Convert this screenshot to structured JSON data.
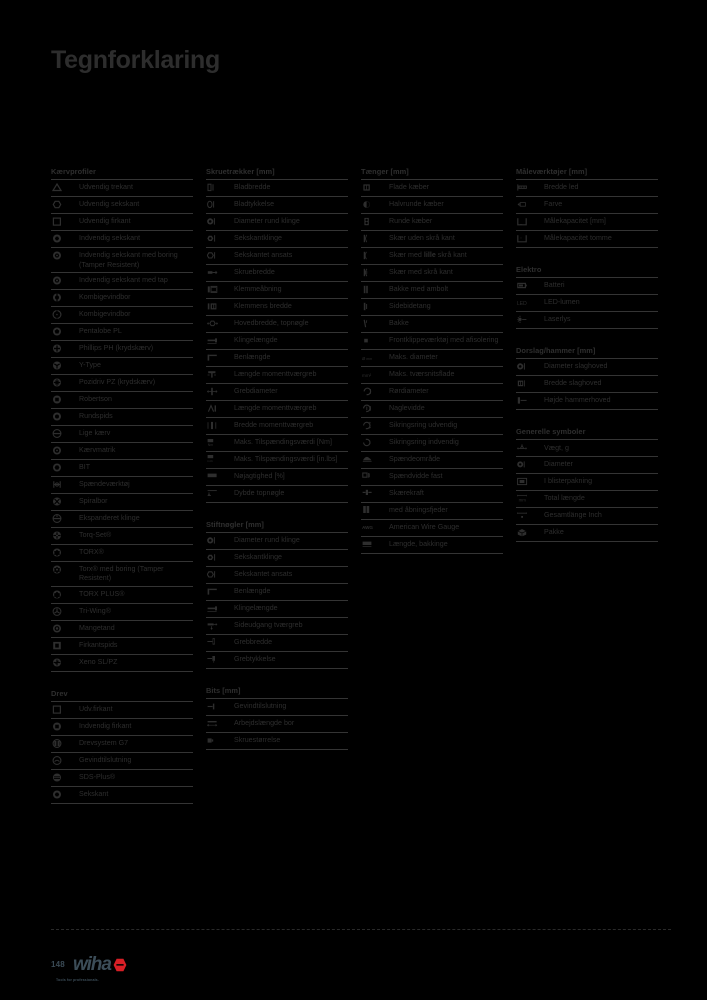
{
  "page": {
    "title": "Tegnforklaring",
    "number": "148",
    "brand": "wiha",
    "brand_tagline": "Tools for professionals."
  },
  "colors": {
    "background": "#000000",
    "text": "#2e2e2e",
    "rule": "#343434",
    "brand_blue": "#3c4d58",
    "brand_red": "#d81f26"
  },
  "columns": [
    {
      "sections": [
        {
          "title": "Kærvprofiler",
          "rows": [
            {
              "icon": "outer-triangle-icon",
              "label": "Udvendig trekant"
            },
            {
              "icon": "outer-hexagon-icon",
              "label": "Udvendig sekskant"
            },
            {
              "icon": "outer-square-icon",
              "label": "Udvendig firkant"
            },
            {
              "icon": "inner-hexagon-icon",
              "label": "Indvendig sekskant"
            },
            {
              "icon": "inner-hexagon-bore-icon",
              "label": "Indvendig sekskant med boring (Tamper Resistent)"
            },
            {
              "icon": "inner-hexagon-pin-icon",
              "label": "Indvendig sekskant med tap"
            },
            {
              "icon": "combi-thread-drill-icon",
              "label": "Kombigevindbor"
            },
            {
              "icon": "combi-thread-drill-open-icon",
              "label": "Kombigevindbor"
            },
            {
              "icon": "pentalobe-icon",
              "label": "Pentalobe PL"
            },
            {
              "icon": "phillips-ph-icon",
              "label": "Phillips PH (krydskærv)"
            },
            {
              "icon": "y-type-icon",
              "label": "Y-Type"
            },
            {
              "icon": "pozidriv-pz-icon",
              "label": "Pozidriv PZ (krydskærv)"
            },
            {
              "icon": "robertson-icon",
              "label": "Robertson"
            },
            {
              "icon": "round-socket-icon",
              "label": "Rundspids"
            },
            {
              "icon": "slotted-icon",
              "label": "Lige kærv"
            },
            {
              "icon": "kaervmatrik-icon",
              "label": "Kærvmatrik"
            },
            {
              "icon": "bit-icon",
              "label": "BIT"
            },
            {
              "icon": "tensioning-tool-icon",
              "label": "Spændeværktøj"
            },
            {
              "icon": "spiral-drill-icon",
              "label": "Spiralbor"
            },
            {
              "icon": "expanding-blade-icon",
              "label": "Ekspanderet klinge"
            },
            {
              "icon": "torq-set-icon",
              "label": "Torq-Set®"
            },
            {
              "icon": "torx-icon",
              "label": "TORX®"
            },
            {
              "icon": "torx-bore-icon",
              "label": "Torx® med boring (Tamper Resistent)"
            },
            {
              "icon": "torx-plus-icon",
              "label": "TORX PLUS®"
            },
            {
              "icon": "tri-wing-icon",
              "label": "Tri-Wing®"
            },
            {
              "icon": "many-teeth-icon",
              "label": "Mangetand"
            },
            {
              "icon": "square-tip-icon",
              "label": "Firkantspids"
            },
            {
              "icon": "xeno-slpz-icon",
              "label": "Xeno SL/PZ"
            }
          ]
        },
        {
          "title": "Drev",
          "rows": [
            {
              "icon": "outer-square-icon",
              "label": "Udv.firkant"
            },
            {
              "icon": "inner-square-icon",
              "label": "Indvendig firkant"
            },
            {
              "icon": "drive-system-g7-icon",
              "label": "Drevsystem G7"
            },
            {
              "icon": "thread-connection-icon",
              "label": "Gevindtilslutning"
            },
            {
              "icon": "sds-plus-icon",
              "label": "SDS-Plus®"
            },
            {
              "icon": "hexagon-icon",
              "label": "Sekskant"
            }
          ]
        }
      ]
    },
    {
      "sections": [
        {
          "title": "Skruetrækker [mm]",
          "rows": [
            {
              "icon": "blade-width-icon",
              "label": "Bladbredde"
            },
            {
              "icon": "blade-thickness-icon",
              "label": "Bladtykkelse"
            },
            {
              "icon": "round-blade-diameter-icon",
              "label": "Diameter rund klinge"
            },
            {
              "icon": "hex-blade-icon",
              "label": "Sekskantklinge"
            },
            {
              "icon": "hex-surface-icon",
              "label": "Sekskantet ansats"
            },
            {
              "icon": "screw-width-icon",
              "label": "Skruebredde"
            },
            {
              "icon": "clamping-range-icon",
              "label": "Klemmeåbning"
            },
            {
              "icon": "clamp-width-icon",
              "label": "Klemmens bredde"
            },
            {
              "icon": "head-width-box-spanner-icon",
              "label": "Hovedbredde, topnøgle"
            },
            {
              "icon": "blade-length-icon",
              "label": "Klingelængde"
            },
            {
              "icon": "leg-length-icon",
              "label": "Benlængde"
            },
            {
              "icon": "torque-crossbar-length-icon",
              "label": "Længde momenttværgreb"
            },
            {
              "icon": "handle-diameter-icon",
              "label": "Grebdiameter"
            },
            {
              "icon": "torque-crossbar-length2-icon",
              "label": "Længde momenttværgreb"
            },
            {
              "icon": "torque-crossbar-width-icon",
              "label": "Bredde momenttværgreb"
            },
            {
              "icon": "max-torque-nm-icon",
              "label": "Maks. Tilspændingsværdi [Nm]"
            },
            {
              "icon": "max-torque-inlbs-icon",
              "label": "Maks. Tilspændingsværdi [in.lbs]"
            },
            {
              "icon": "accuracy-icon",
              "label": "Nøjagtighed [%]"
            },
            {
              "icon": "depth-box-spanner-icon",
              "label": "Dybde topnøgle"
            }
          ]
        },
        {
          "title": "Stiftnøgler [mm]",
          "rows": [
            {
              "icon": "round-blade-diameter-icon",
              "label": "Diameter rund klinge"
            },
            {
              "icon": "hex-blade-icon",
              "label": "Sekskantklinge"
            },
            {
              "icon": "hex-surface-icon",
              "label": "Sekskantet ansats"
            },
            {
              "icon": "leg-length-icon",
              "label": "Benlængde"
            },
            {
              "icon": "blade-length-icon",
              "label": "Klingelængde"
            },
            {
              "icon": "side-exit-crossbar-icon",
              "label": "Sideudgang tværgreb"
            },
            {
              "icon": "handle-width-icon",
              "label": "Grebbredde"
            },
            {
              "icon": "handle-thickness-icon",
              "label": "Grebtykkelse"
            }
          ]
        },
        {
          "title": "Bits [mm]",
          "rows": [
            {
              "icon": "thread-connection-bit-icon",
              "label": "Gevindtilslutning"
            },
            {
              "icon": "working-length-drill-icon",
              "label": "Arbejdslængde bor"
            },
            {
              "icon": "screw-size-icon",
              "label": "Skruestørrelse"
            }
          ]
        }
      ]
    },
    {
      "sections": [
        {
          "title": "Tænger [mm]",
          "rows": [
            {
              "icon": "flat-jaws-icon",
              "label": "Flade kæber"
            },
            {
              "icon": "half-round-jaws-icon",
              "label": "Halvrunde kæber"
            },
            {
              "icon": "round-jaws-icon",
              "label": "Runde kæber"
            },
            {
              "icon": "cut-without-bevel-icon",
              "label": "Skær uden skrå kant"
            },
            {
              "icon": "cut-small-bevel-icon",
              "label": "Skær med <b>lille</b> skrå kant"
            },
            {
              "icon": "cut-with-bevel-icon",
              "label": "Skær med skrå kant"
            },
            {
              "icon": "jaw-with-anvil-icon",
              "label": "Bakke med ambolt"
            },
            {
              "icon": "side-cutter-icon",
              "label": "Sidebidetang"
            },
            {
              "icon": "jaw-icon",
              "label": "Bakke"
            },
            {
              "icon": "front-cutter-tool-icon",
              "label": "Frontklippeværktøj med afisolering"
            },
            {
              "icon": "max-diameter-icon",
              "label": "Maks. diameter"
            },
            {
              "icon": "max-cross-section-icon",
              "label": "Maks. tværsnitsflade"
            },
            {
              "icon": "round-diameter-icon",
              "label": "Rørdiameter"
            },
            {
              "icon": "nail-width-icon",
              "label": "Naglevidde"
            },
            {
              "icon": "circlip-outer-icon",
              "label": "Sikringsring udvendig"
            },
            {
              "icon": "circlip-inner-icon",
              "label": "Sikringsring indvendig"
            },
            {
              "icon": "clamping-area-icon",
              "label": "Spændeområde"
            },
            {
              "icon": "clamping-width-fixed-icon",
              "label": "Spændvidde fast"
            },
            {
              "icon": "cutting-force-icon",
              "label": "Skærekraft"
            },
            {
              "icon": "with-opening-spring-icon",
              "label": "med åbningsfjeder"
            },
            {
              "icon": "awg-icon",
              "label": "American Wire Gauge"
            },
            {
              "icon": "length-jaws-icon",
              "label": "Længde, bakkinge"
            }
          ]
        }
      ]
    },
    {
      "sections": [
        {
          "title": "Måleværktøjer [mm]",
          "rows": [
            {
              "icon": "joint-width-icon",
              "label": "Bredde led"
            },
            {
              "icon": "colour-icon",
              "label": "Farve"
            },
            {
              "icon": "measuring-capacity-mm-icon",
              "label": "Målekapacitet [mm]"
            },
            {
              "icon": "measuring-capacity-inch-icon",
              "label": "Målekapacitet tomme"
            }
          ]
        },
        {
          "title": "Elektro",
          "rows": [
            {
              "icon": "battery-icon",
              "label": "Batteri"
            },
            {
              "icon": "led-lumen-icon",
              "label": "LED-lumen"
            },
            {
              "icon": "laser-light-icon",
              "label": "Laserlys"
            }
          ]
        },
        {
          "title": "Dorslag/hammer [mm]",
          "rows": [
            {
              "icon": "striking-head-diameter-icon",
              "label": "Diameter slaghoved"
            },
            {
              "icon": "striking-head-width-icon",
              "label": "Bredde slaghoved"
            },
            {
              "icon": "hammer-head-height-icon",
              "label": "Højde hammerhoved"
            }
          ]
        },
        {
          "title": "Generelle symboler",
          "rows": [
            {
              "icon": "weight-icon",
              "label": "Vægt, g"
            },
            {
              "icon": "diameter-icon",
              "label": "Diameter"
            },
            {
              "icon": "blister-pack-icon",
              "label": "I blisterpakning"
            },
            {
              "icon": "total-length-icon",
              "label": "Total længde"
            },
            {
              "icon": "total-length-inch-icon",
              "label": "Gesamtlänge Inch"
            },
            {
              "icon": "packaging-icon",
              "label": "Pakke"
            }
          ]
        }
      ]
    }
  ]
}
